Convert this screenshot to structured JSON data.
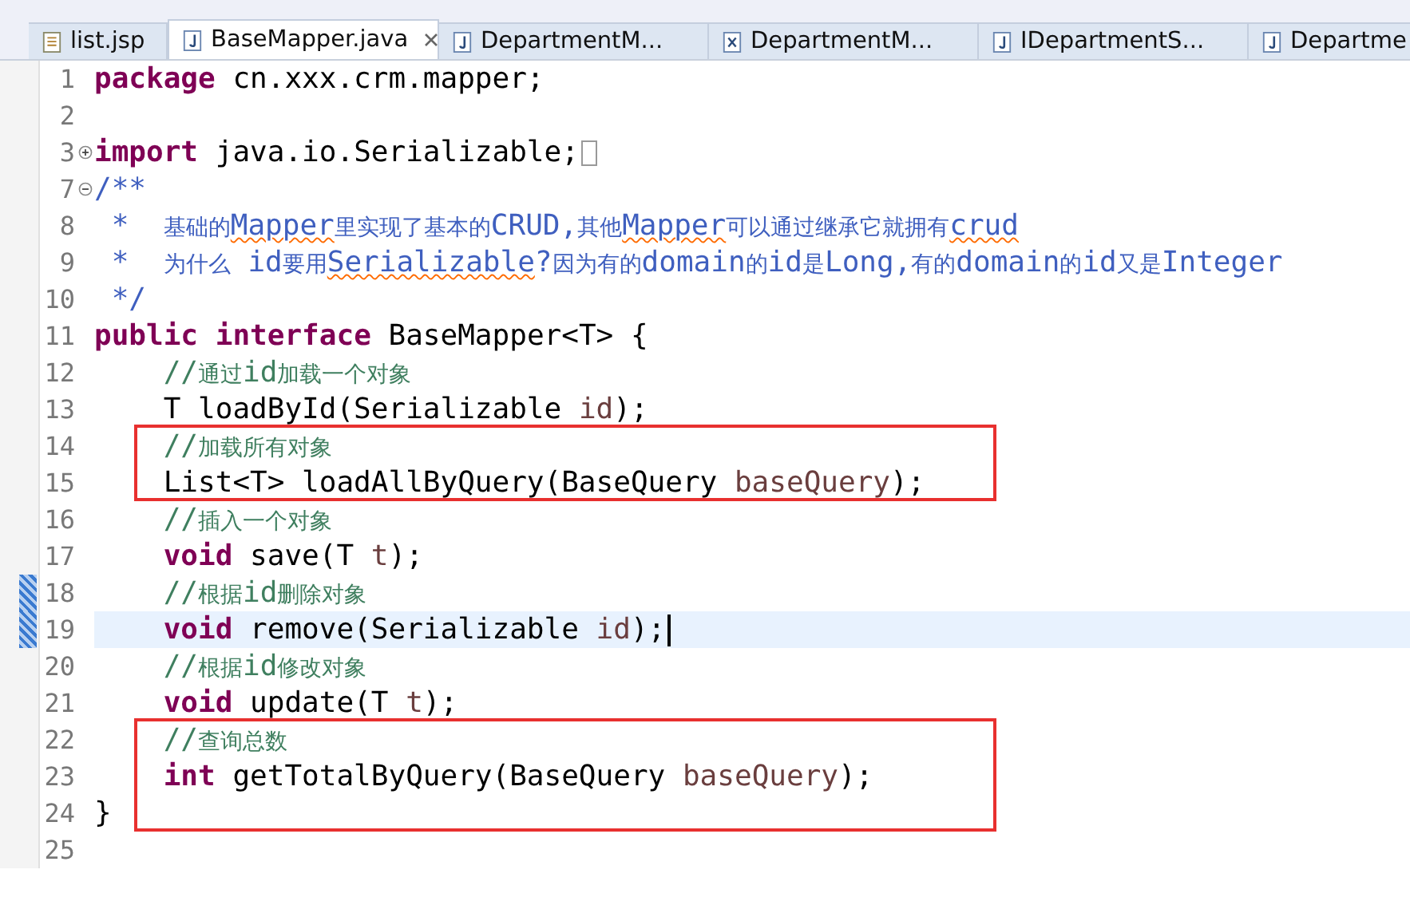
{
  "tabs": [
    {
      "label": "list.jsp",
      "kind": "jsp",
      "selected": false,
      "closable": false
    },
    {
      "label": "BaseMapper.java",
      "kind": "java",
      "selected": true,
      "closable": true
    },
    {
      "label": "DepartmentM...",
      "kind": "java",
      "selected": false,
      "closable": false
    },
    {
      "label": "DepartmentM...",
      "kind": "xml",
      "selected": false,
      "closable": false
    },
    {
      "label": "IDepartmentS...",
      "kind": "java",
      "selected": false,
      "closable": false
    },
    {
      "label": "Departme",
      "kind": "java",
      "selected": false,
      "closable": false
    }
  ],
  "lines": [
    {
      "number": "1",
      "tokens": [
        {
          "kind": "keyword",
          "text": "package"
        },
        {
          "kind": "plain",
          "text": " cn.xxx.crm.mapper;"
        }
      ]
    },
    {
      "number": "2"
    },
    {
      "number": "3",
      "foldable": true,
      "collapsed": true,
      "tokens": [
        {
          "kind": "keyword",
          "text": "import"
        },
        {
          "kind": "plain",
          "text": " java.io.Serializable;"
        }
      ]
    },
    {
      "number": "7",
      "foldable": true,
      "collapsed": false,
      "tokens": [
        {
          "kind": "javadoc",
          "text": "/**"
        }
      ]
    },
    {
      "number": "8",
      "tokens": [
        {
          "kind": "javadoc",
          "text": " *  基础的"
        },
        {
          "kind": "javadoc",
          "text": "Mapper",
          "misspelled": true
        },
        {
          "kind": "javadoc",
          "text": "里实现了基本的CRUD,其他"
        },
        {
          "kind": "javadoc",
          "text": "Mapper",
          "misspelled": true
        },
        {
          "kind": "javadoc",
          "text": "可以通过继承它就拥有"
        },
        {
          "kind": "javadoc",
          "text": "crud",
          "misspelled": true
        }
      ]
    },
    {
      "number": "9",
      "tokens": [
        {
          "kind": "javadoc",
          "text": " *  为什么 id要用"
        },
        {
          "kind": "javadoc",
          "text": "Serializable",
          "misspelled": true
        },
        {
          "kind": "javadoc",
          "text": "?因为有的domain的id是Long,有的domain的id又是Integer"
        }
      ]
    },
    {
      "number": "10",
      "tokens": [
        {
          "kind": "javadoc",
          "text": " */"
        }
      ]
    },
    {
      "number": "11",
      "tokens": [
        {
          "kind": "keyword",
          "text": "public"
        },
        {
          "kind": "keyword",
          "text": " interface"
        },
        {
          "kind": "plain",
          "text": " BaseMapper<T> {"
        }
      ]
    },
    {
      "number": "12",
      "tokens": [
        {
          "kind": "comment",
          "text": "    //通过id加载一个对象"
        }
      ]
    },
    {
      "number": "13",
      "tokens": [
        {
          "kind": "plain",
          "text": "    T loadById(Serializable "
        },
        {
          "kind": "param",
          "text": "id"
        },
        {
          "kind": "plain",
          "text": ");"
        }
      ]
    },
    {
      "number": "14",
      "boxed": true,
      "tokens": [
        {
          "kind": "comment",
          "text": "    //加载所有对象"
        }
      ]
    },
    {
      "number": "15",
      "boxed": true,
      "tokens": [
        {
          "kind": "plain",
          "text": "    List<T> loadAllByQuery(BaseQuery "
        },
        {
          "kind": "param",
          "text": "baseQuery"
        },
        {
          "kind": "plain",
          "text": ");"
        }
      ]
    },
    {
      "number": "16",
      "tokens": [
        {
          "kind": "comment",
          "text": "    //插入一个对象"
        }
      ]
    },
    {
      "number": "17",
      "tokens": [
        {
          "kind": "keyword",
          "text": "    void"
        },
        {
          "kind": "plain",
          "text": " save(T "
        },
        {
          "kind": "param",
          "text": "t"
        },
        {
          "kind": "plain",
          "text": ");"
        }
      ]
    },
    {
      "number": "18",
      "changed": true,
      "tokens": [
        {
          "kind": "comment",
          "text": "    //根据id删除对象"
        }
      ]
    },
    {
      "number": "19",
      "changed": true,
      "current": true,
      "tokens": [
        {
          "kind": "keyword",
          "text": "    void"
        },
        {
          "kind": "plain",
          "text": " remove(Serializable "
        },
        {
          "kind": "param",
          "text": "id"
        },
        {
          "kind": "plain",
          "text": ");"
        }
      ]
    },
    {
      "number": "20",
      "tokens": [
        {
          "kind": "comment",
          "text": "    //根据id修改对象"
        }
      ]
    },
    {
      "number": "21",
      "tokens": [
        {
          "kind": "keyword",
          "text": "    void"
        },
        {
          "kind": "plain",
          "text": " update(T "
        },
        {
          "kind": "param",
          "text": "t"
        },
        {
          "kind": "plain",
          "text": ");"
        }
      ]
    },
    {
      "number": "22",
      "boxed": true,
      "tokens": [
        {
          "kind": "comment",
          "text": "    //查询总数"
        }
      ]
    },
    {
      "number": "23",
      "boxed": true,
      "tokens": [
        {
          "kind": "keyword",
          "text": "    int"
        },
        {
          "kind": "plain",
          "text": " getTotalByQuery(BaseQuery "
        },
        {
          "kind": "param",
          "text": "baseQuery"
        },
        {
          "kind": "plain",
          "text": ");"
        }
      ]
    },
    {
      "number": "24",
      "boxed": true,
      "tokens": [
        {
          "kind": "plain",
          "text": "}"
        }
      ]
    },
    {
      "number": "25"
    }
  ]
}
